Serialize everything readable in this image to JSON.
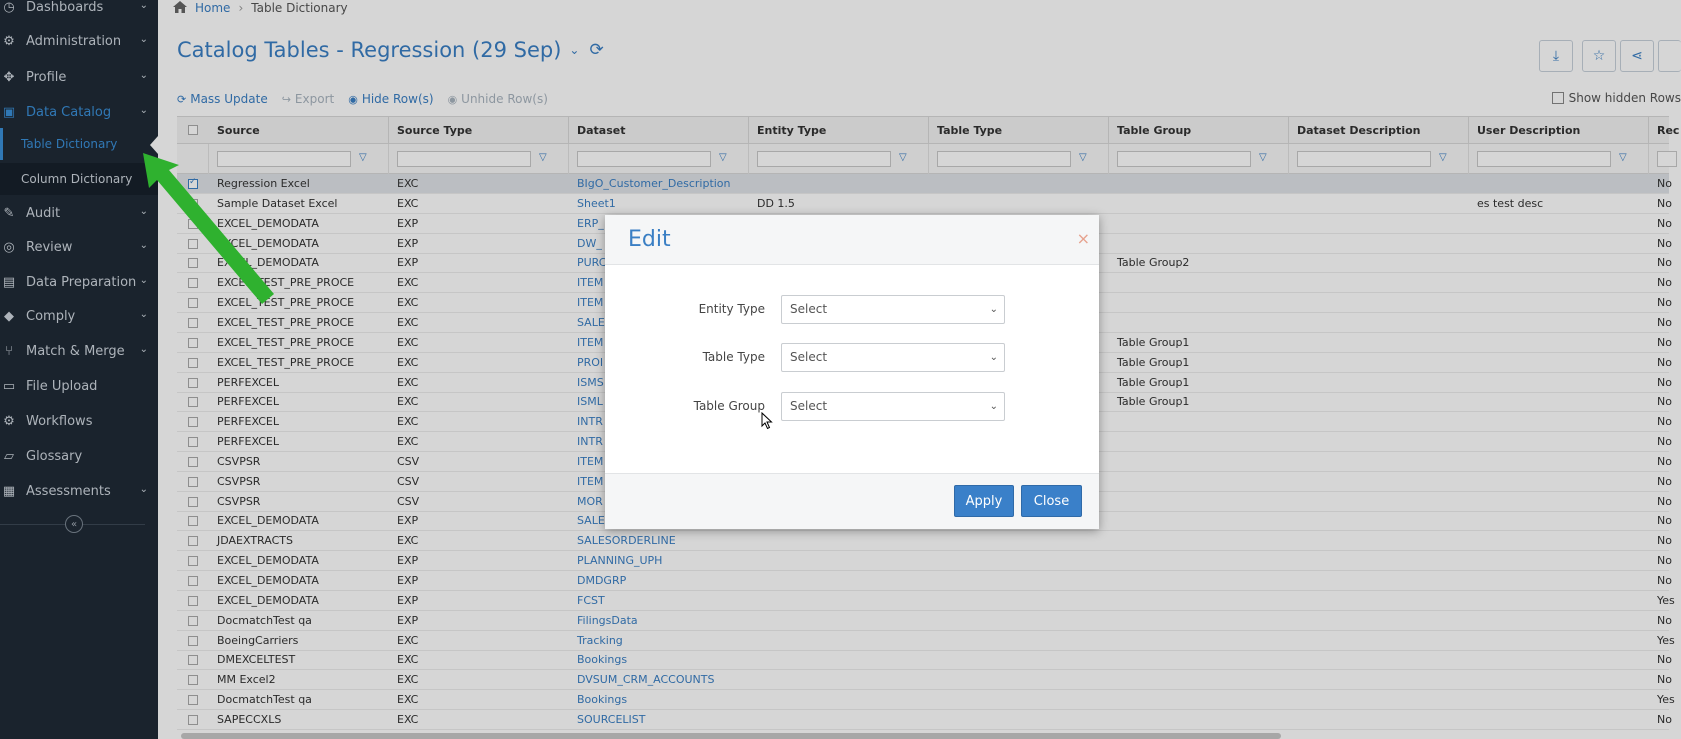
{
  "sidebar": {
    "items": [
      {
        "label": "Dashboards",
        "icon": "dashboard-icon",
        "chevron": true
      },
      {
        "label": "Administration",
        "icon": "gear-icon",
        "chevron": true
      },
      {
        "label": "Profile",
        "icon": "profile-icon",
        "chevron": true
      },
      {
        "label": "Data Catalog",
        "icon": "catalog-icon",
        "chevron": true,
        "active": true
      },
      {
        "label": "Audit",
        "icon": "audit-icon",
        "chevron": true
      },
      {
        "label": "Review",
        "icon": "review-icon",
        "chevron": true
      },
      {
        "label": "Data Preparation",
        "icon": "data-prep-icon",
        "chevron": true
      },
      {
        "label": "Comply",
        "icon": "tag-icon",
        "chevron": true
      },
      {
        "label": "Match & Merge",
        "icon": "merge-icon",
        "chevron": true
      },
      {
        "label": "File Upload",
        "icon": "file-icon",
        "chevron": false
      },
      {
        "label": "Workflows",
        "icon": "workflow-icon",
        "chevron": false
      },
      {
        "label": "Glossary",
        "icon": "glossary-icon",
        "chevron": false
      },
      {
        "label": "Assessments",
        "icon": "assessment-icon",
        "chevron": true
      }
    ],
    "sub_items": [
      {
        "label": "Table Dictionary",
        "active": true
      },
      {
        "label": "Column Dictionary",
        "active": false
      }
    ],
    "collapse_glyph": "«"
  },
  "breadcrumb": {
    "home": "Home",
    "current": "Table Dictionary"
  },
  "page": {
    "title": "Catalog Tables - Regression (29 Sep)",
    "title_chevron": "⌄",
    "refresh_glyph": "⟳"
  },
  "top_buttons": [
    {
      "icon": "download-icon",
      "glyph": "⤓"
    },
    {
      "icon": "star-icon",
      "glyph": "☆"
    },
    {
      "icon": "share-icon",
      "glyph": "⋖"
    }
  ],
  "toolbar": {
    "mass_update": "Mass Update",
    "export": "Export",
    "hide_rows": "Hide Row(s)",
    "unhide_rows": "Unhide Row(s)",
    "show_hidden": "Show hidden Rows"
  },
  "grid": {
    "columns": [
      "Source",
      "Source Type",
      "Dataset",
      "Entity Type",
      "Table Type",
      "Table Group",
      "Dataset Description",
      "User Description",
      "Rec"
    ],
    "rows": [
      {
        "source": "Regression Excel",
        "type": "EXC",
        "dataset": "BIgO_Customer_Description",
        "entity": "",
        "group": "",
        "user_desc": "",
        "rec": "No",
        "selected": true
      },
      {
        "source": "Sample Dataset Excel",
        "type": "EXC",
        "dataset": "Sheet1",
        "entity": "DD 1.5",
        "group": "",
        "user_desc": "es test desc",
        "rec": "No"
      },
      {
        "source": "EXCEL_DEMODATA",
        "type": "EXP",
        "dataset": "ERP_",
        "entity": "",
        "group": "",
        "user_desc": "",
        "rec": "No"
      },
      {
        "source": "EXCEL_DEMODATA",
        "type": "EXP",
        "dataset": "DW_",
        "entity": "",
        "group": "",
        "user_desc": "",
        "rec": "No"
      },
      {
        "source": "EXCEL_DEMODATA",
        "type": "EXP",
        "dataset": "PURC",
        "entity": "",
        "group": "Table Group2",
        "user_desc": "",
        "rec": "No"
      },
      {
        "source": "EXCEL_TEST_PRE_PROCE",
        "type": "EXC",
        "dataset": "ITEM",
        "entity": "",
        "group": "",
        "user_desc": "",
        "rec": "No"
      },
      {
        "source": "EXCEL_TEST_PRE_PROCE",
        "type": "EXC",
        "dataset": "ITEM",
        "entity": "",
        "group": "",
        "user_desc": "",
        "rec": "No"
      },
      {
        "source": "EXCEL_TEST_PRE_PROCE",
        "type": "EXC",
        "dataset": "SALE",
        "entity": "",
        "group": "",
        "user_desc": "",
        "rec": "No"
      },
      {
        "source": "EXCEL_TEST_PRE_PROCE",
        "type": "EXC",
        "dataset": "ITEM",
        "entity": "",
        "group": "Table Group1",
        "user_desc": "",
        "rec": "No"
      },
      {
        "source": "EXCEL_TEST_PRE_PROCE",
        "type": "EXC",
        "dataset": "PROI",
        "entity": "",
        "group": "Table Group1",
        "user_desc": "",
        "rec": "No"
      },
      {
        "source": "PERFEXCEL",
        "type": "EXC",
        "dataset": "ISMS",
        "entity": "",
        "group": "Table Group1",
        "user_desc": "",
        "rec": "No"
      },
      {
        "source": "PERFEXCEL",
        "type": "EXC",
        "dataset": "ISML",
        "entity": "",
        "group": "Table Group1",
        "user_desc": "",
        "rec": "No"
      },
      {
        "source": "PERFEXCEL",
        "type": "EXC",
        "dataset": "INTR",
        "entity": "",
        "group": "",
        "user_desc": "",
        "rec": "No"
      },
      {
        "source": "PERFEXCEL",
        "type": "EXC",
        "dataset": "INTR",
        "entity": "",
        "group": "",
        "user_desc": "",
        "rec": "No"
      },
      {
        "source": "CSVPSR",
        "type": "CSV",
        "dataset": "ITEM",
        "entity": "",
        "group": "",
        "user_desc": "",
        "rec": "No"
      },
      {
        "source": "CSVPSR",
        "type": "CSV",
        "dataset": "ITEM",
        "entity": "",
        "group": "",
        "user_desc": "",
        "rec": "No"
      },
      {
        "source": "CSVPSR",
        "type": "CSV",
        "dataset": "MOR",
        "entity": "",
        "group": "",
        "user_desc": "",
        "rec": "No"
      },
      {
        "source": "EXCEL_DEMODATA",
        "type": "EXP",
        "dataset": "SALE",
        "entity": "",
        "group": "",
        "user_desc": "",
        "rec": "No"
      },
      {
        "source": "JDAEXTRACTS",
        "type": "EXC",
        "dataset": "SALESORDERLINE",
        "entity": "",
        "group": "",
        "user_desc": "",
        "rec": "No"
      },
      {
        "source": "EXCEL_DEMODATA",
        "type": "EXP",
        "dataset": "PLANNING_UPH",
        "entity": "",
        "group": "",
        "user_desc": "",
        "rec": "No"
      },
      {
        "source": "EXCEL_DEMODATA",
        "type": "EXP",
        "dataset": "DMDGRP",
        "entity": "",
        "group": "",
        "user_desc": "",
        "rec": "No"
      },
      {
        "source": "EXCEL_DEMODATA",
        "type": "EXP",
        "dataset": "FCST",
        "entity": "",
        "group": "",
        "user_desc": "",
        "rec": "Yes"
      },
      {
        "source": "DocmatchTest qa",
        "type": "EXP",
        "dataset": "FilingsData",
        "entity": "",
        "group": "",
        "user_desc": "",
        "rec": "No"
      },
      {
        "source": "BoeingCarriers",
        "type": "EXC",
        "dataset": "Tracking",
        "entity": "",
        "group": "",
        "user_desc": "",
        "rec": "Yes"
      },
      {
        "source": "DMEXCELTEST",
        "type": "EXC",
        "dataset": "Bookings",
        "entity": "",
        "group": "",
        "user_desc": "",
        "rec": "No"
      },
      {
        "source": "MM Excel2",
        "type": "EXC",
        "dataset": "DVSUM_CRM_ACCOUNTS",
        "entity": "",
        "group": "",
        "user_desc": "",
        "rec": "No"
      },
      {
        "source": "DocmatchTest qa",
        "type": "EXC",
        "dataset": "Bookings",
        "entity": "",
        "group": "",
        "user_desc": "",
        "rec": "Yes"
      },
      {
        "source": "SAPECCXLS",
        "type": "EXC",
        "dataset": "SOURCELIST",
        "entity": "",
        "group": "",
        "user_desc": "",
        "rec": "No"
      }
    ]
  },
  "modal": {
    "title": "Edit",
    "close_glyph": "×",
    "fields": [
      {
        "label": "Entity Type",
        "value": "Select"
      },
      {
        "label": "Table Type",
        "value": "Select"
      },
      {
        "label": "Table Group",
        "value": "Select"
      }
    ],
    "apply": "Apply",
    "close": "Close"
  },
  "colors": {
    "accent": "#3a7fc4",
    "sidebar_bg": "#1f2a36",
    "arrow": "#2fb12f"
  }
}
